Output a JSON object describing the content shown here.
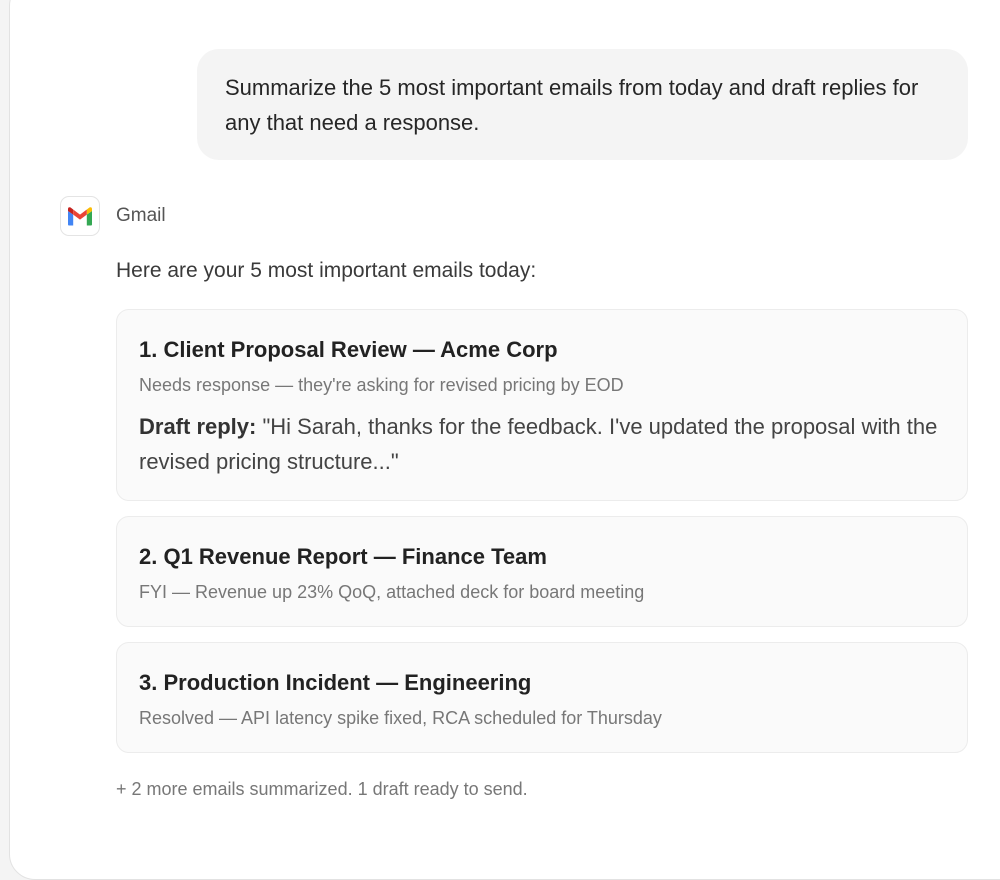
{
  "user_message": {
    "text": "Summarize the 5 most important emails from today and draft replies for any that need a response."
  },
  "assistant": {
    "source": {
      "name": "Gmail",
      "icon": "gmail-icon"
    },
    "intro": "Here are your 5 most important emails today:",
    "emails": [
      {
        "title": "1. Client Proposal Review — Acme Corp",
        "summary": "Needs response — they're asking for revised pricing by EOD",
        "draft_label": "Draft reply:",
        "draft_text": " \"Hi Sarah, thanks for the feedback. I've updated the proposal with the revised pricing structure...\""
      },
      {
        "title": "2. Q1 Revenue Report — Finance Team",
        "summary": "FYI — Revenue up 23% QoQ, attached deck for board meeting"
      },
      {
        "title": "3. Production Incident — Engineering",
        "summary": "Resolved — API latency spike fixed, RCA scheduled for Thursday"
      }
    ],
    "footer": "+ 2 more emails summarized. 1 draft ready to send."
  },
  "colors": {
    "gmail_red": "#EA4335",
    "gmail_blue": "#4285F4",
    "gmail_green": "#34A853",
    "gmail_yellow": "#FBBC04",
    "gmail_dark_red": "#C5221F"
  }
}
